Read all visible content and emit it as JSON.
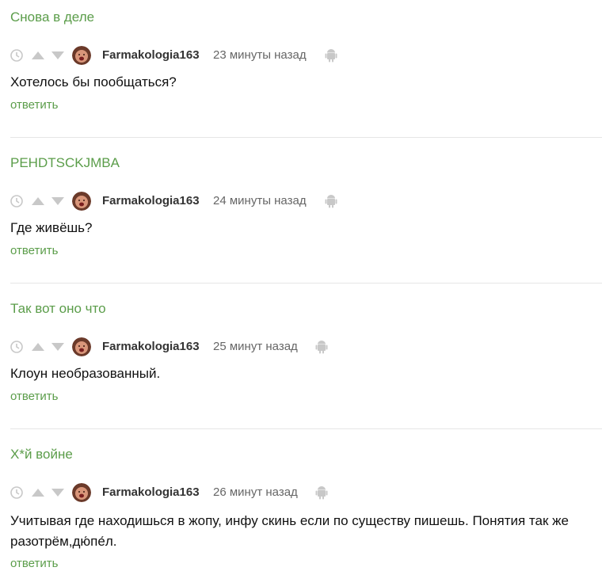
{
  "comments": [
    {
      "parent_title": "Снова в деле",
      "username": "Farmakologia163",
      "time": "23 минуты назад",
      "text": "Хотелось бы пообщаться?",
      "reply_label": "ответить"
    },
    {
      "parent_title": "PEHDTSCKJMBA",
      "username": "Farmakologia163",
      "time": "24 минуты назад",
      "text": "Где живёшь?",
      "reply_label": "ответить"
    },
    {
      "parent_title": "Так вот оно что",
      "username": "Farmakologia163",
      "time": "25 минут назад",
      "text": "Клоун необразованный.",
      "reply_label": "ответить"
    },
    {
      "parent_title": "Х*й войне",
      "username": "Farmakologia163",
      "time": "26 минут назад",
      "text": "Учитывая где находишься в жопу, инфу скинь если по существу пишешь. Понятия так же разотрём,дю́пе́л.",
      "reply_label": "ответить"
    }
  ],
  "icons": {
    "clock": "clock-icon",
    "upvote": "upvote-arrow-icon",
    "downvote": "downvote-arrow-icon",
    "device": "android-icon"
  },
  "colors": {
    "accent_green": "#5b9d4a",
    "icon_gray": "#c8c8c8",
    "divider": "#e6e6e6",
    "text": "#111111",
    "meta_text": "#666666"
  }
}
